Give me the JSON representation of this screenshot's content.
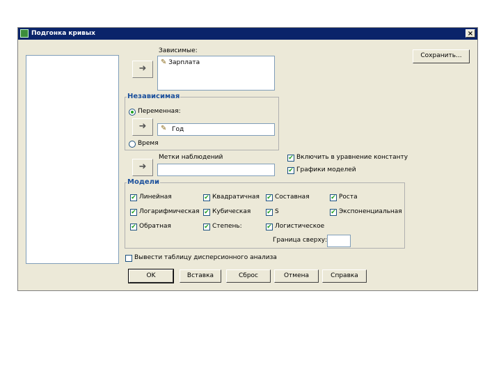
{
  "window": {
    "title": "Подгонка кривых",
    "close": "×"
  },
  "dependent": {
    "label": "Зависимые:",
    "items": [
      {
        "icon": "ruler-icon",
        "name": "Зарплата"
      }
    ]
  },
  "independent": {
    "group_title": "Независимая",
    "variable_label": "Переменная:",
    "variable_value": "Год",
    "time_label": "Время",
    "selected": "variable"
  },
  "case_labels": {
    "label": "Метки наблюдений",
    "value": ""
  },
  "options": {
    "include_constant": {
      "label": "Включить в уравнение константу",
      "checked": true
    },
    "plot_models": {
      "label": "Графики моделей",
      "checked": true
    }
  },
  "models": {
    "group_title": "Модели",
    "items": [
      {
        "label": "Линейная",
        "checked": true
      },
      {
        "label": "Квадратичная",
        "checked": true
      },
      {
        "label": "Составная",
        "checked": true
      },
      {
        "label": "Роста",
        "checked": true
      },
      {
        "label": "Логарифмическая",
        "checked": true
      },
      {
        "label": "Кубическая",
        "checked": true
      },
      {
        "label": "S",
        "checked": true
      },
      {
        "label": "Экспоненциальная",
        "checked": true
      },
      {
        "label": "Обратная",
        "checked": true
      },
      {
        "label": "Степень:",
        "checked": true
      },
      {
        "label": "Логистическое",
        "checked": true
      }
    ],
    "upper_bound_label": "Граница сверху:",
    "upper_bound_value": ""
  },
  "anova": {
    "label": "Вывести таблицу дисперсионного анализа",
    "checked": false
  },
  "buttons": {
    "save": "Сохранить...",
    "ok": "OK",
    "paste": "Вставка",
    "reset": "Сброс",
    "cancel": "Отмена",
    "help": "Справка"
  },
  "icons": {
    "arrow": "arrow-right-icon",
    "variable": "ruler-icon"
  },
  "colors": {
    "titlebar": "#0a246a",
    "dialog": "#ece9d8",
    "group_title": "#1a4f9c",
    "check": "#21a121"
  }
}
